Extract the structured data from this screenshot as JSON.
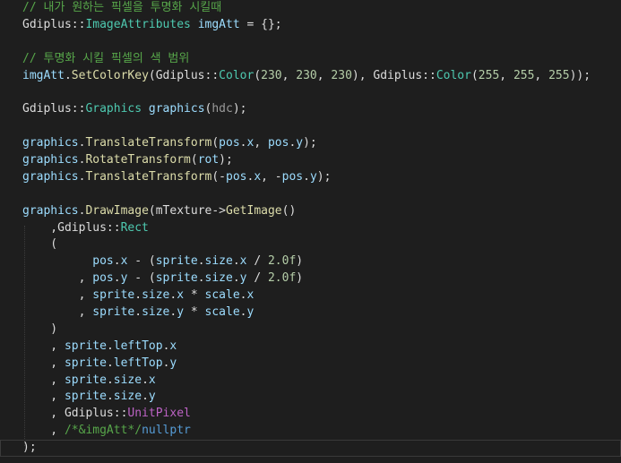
{
  "editor": {
    "language": "C++",
    "theme_colors": {
      "background": "#1e1e1e",
      "comment": "#57a64a",
      "type": "#4ec9b0",
      "function": "#dcdcaa",
      "variable": "#9cdcfe",
      "number": "#b5cea8",
      "plain": "#dcdcdc",
      "keyword": "#569cd6",
      "parameter": "#9a9a9a"
    },
    "lines": [
      [
        {
          "t": "// 내가 원하는 픽셀을 투명화 시킬때",
          "k": "cm"
        }
      ],
      [
        {
          "t": "Gdiplus",
          "k": "pl"
        },
        {
          "t": "::",
          "k": "pl"
        },
        {
          "t": "ImageAttributes",
          "k": "ty"
        },
        {
          "t": " ",
          "k": "pl"
        },
        {
          "t": "imgAtt",
          "k": "vr"
        },
        {
          "t": " = {};",
          "k": "pl"
        }
      ],
      [],
      [
        {
          "t": "// 투명화 시킬 픽셀의 색 범위",
          "k": "cm"
        }
      ],
      [
        {
          "t": "imgAtt",
          "k": "vr"
        },
        {
          "t": ".",
          "k": "pl"
        },
        {
          "t": "SetColorKey",
          "k": "fn"
        },
        {
          "t": "(Gdiplus::",
          "k": "pl"
        },
        {
          "t": "Color",
          "k": "ty"
        },
        {
          "t": "(",
          "k": "pl"
        },
        {
          "t": "230",
          "k": "nm"
        },
        {
          "t": ", ",
          "k": "pl"
        },
        {
          "t": "230",
          "k": "nm"
        },
        {
          "t": ", ",
          "k": "pl"
        },
        {
          "t": "230",
          "k": "nm"
        },
        {
          "t": "), Gdiplus::",
          "k": "pl"
        },
        {
          "t": "Color",
          "k": "ty"
        },
        {
          "t": "(",
          "k": "pl"
        },
        {
          "t": "255",
          "k": "nm"
        },
        {
          "t": ", ",
          "k": "pl"
        },
        {
          "t": "255",
          "k": "nm"
        },
        {
          "t": ", ",
          "k": "pl"
        },
        {
          "t": "255",
          "k": "nm"
        },
        {
          "t": "));",
          "k": "pl"
        }
      ],
      [],
      [
        {
          "t": "Gdiplus",
          "k": "pl"
        },
        {
          "t": "::",
          "k": "pl"
        },
        {
          "t": "Graphics",
          "k": "ty"
        },
        {
          "t": " ",
          "k": "pl"
        },
        {
          "t": "graphics",
          "k": "vr"
        },
        {
          "t": "(",
          "k": "pl"
        },
        {
          "t": "hdc",
          "k": "pm"
        },
        {
          "t": ");",
          "k": "pl"
        }
      ],
      [],
      [
        {
          "t": "graphics",
          "k": "vr"
        },
        {
          "t": ".",
          "k": "pl"
        },
        {
          "t": "TranslateTransform",
          "k": "fn"
        },
        {
          "t": "(",
          "k": "pl"
        },
        {
          "t": "pos",
          "k": "vr"
        },
        {
          "t": ".",
          "k": "pl"
        },
        {
          "t": "x",
          "k": "vr"
        },
        {
          "t": ", ",
          "k": "pl"
        },
        {
          "t": "pos",
          "k": "vr"
        },
        {
          "t": ".",
          "k": "pl"
        },
        {
          "t": "y",
          "k": "vr"
        },
        {
          "t": ");",
          "k": "pl"
        }
      ],
      [
        {
          "t": "graphics",
          "k": "vr"
        },
        {
          "t": ".",
          "k": "pl"
        },
        {
          "t": "RotateTransform",
          "k": "fn"
        },
        {
          "t": "(",
          "k": "pl"
        },
        {
          "t": "rot",
          "k": "vr"
        },
        {
          "t": ");",
          "k": "pl"
        }
      ],
      [
        {
          "t": "graphics",
          "k": "vr"
        },
        {
          "t": ".",
          "k": "pl"
        },
        {
          "t": "TranslateTransform",
          "k": "fn"
        },
        {
          "t": "(-",
          "k": "pl"
        },
        {
          "t": "pos",
          "k": "vr"
        },
        {
          "t": ".",
          "k": "pl"
        },
        {
          "t": "x",
          "k": "vr"
        },
        {
          "t": ", -",
          "k": "pl"
        },
        {
          "t": "pos",
          "k": "vr"
        },
        {
          "t": ".",
          "k": "pl"
        },
        {
          "t": "y",
          "k": "vr"
        },
        {
          "t": ");",
          "k": "pl"
        }
      ],
      [],
      [
        {
          "t": "graphics",
          "k": "vr"
        },
        {
          "t": ".",
          "k": "pl"
        },
        {
          "t": "DrawImage",
          "k": "fn"
        },
        {
          "t": "(",
          "k": "pl"
        },
        {
          "t": "mTexture",
          "k": "pl"
        },
        {
          "t": "->",
          "k": "pl"
        },
        {
          "t": "GetImage",
          "k": "fn"
        },
        {
          "t": "()",
          "k": "pl"
        }
      ],
      [
        {
          "t": "    ,Gdiplus::",
          "k": "pl"
        },
        {
          "t": "Rect",
          "k": "ty"
        }
      ],
      [
        {
          "t": "    (",
          "k": "pl"
        }
      ],
      [
        {
          "t": "          ",
          "k": "pl"
        },
        {
          "t": "pos",
          "k": "vr"
        },
        {
          "t": ".",
          "k": "pl"
        },
        {
          "t": "x",
          "k": "vr"
        },
        {
          "t": " - (",
          "k": "pl"
        },
        {
          "t": "sprite",
          "k": "vr"
        },
        {
          "t": ".",
          "k": "pl"
        },
        {
          "t": "size",
          "k": "vr"
        },
        {
          "t": ".",
          "k": "pl"
        },
        {
          "t": "x",
          "k": "vr"
        },
        {
          "t": " / ",
          "k": "pl"
        },
        {
          "t": "2.0f",
          "k": "nm"
        },
        {
          "t": ")",
          "k": "pl"
        }
      ],
      [
        {
          "t": "        , ",
          "k": "pl"
        },
        {
          "t": "pos",
          "k": "vr"
        },
        {
          "t": ".",
          "k": "pl"
        },
        {
          "t": "y",
          "k": "vr"
        },
        {
          "t": " - (",
          "k": "pl"
        },
        {
          "t": "sprite",
          "k": "vr"
        },
        {
          "t": ".",
          "k": "pl"
        },
        {
          "t": "size",
          "k": "vr"
        },
        {
          "t": ".",
          "k": "pl"
        },
        {
          "t": "y",
          "k": "vr"
        },
        {
          "t": " / ",
          "k": "pl"
        },
        {
          "t": "2.0f",
          "k": "nm"
        },
        {
          "t": ")",
          "k": "pl"
        }
      ],
      [
        {
          "t": "        , ",
          "k": "pl"
        },
        {
          "t": "sprite",
          "k": "vr"
        },
        {
          "t": ".",
          "k": "pl"
        },
        {
          "t": "size",
          "k": "vr"
        },
        {
          "t": ".",
          "k": "pl"
        },
        {
          "t": "x",
          "k": "vr"
        },
        {
          "t": " * ",
          "k": "pl"
        },
        {
          "t": "scale",
          "k": "vr"
        },
        {
          "t": ".",
          "k": "pl"
        },
        {
          "t": "x",
          "k": "vr"
        }
      ],
      [
        {
          "t": "        , ",
          "k": "pl"
        },
        {
          "t": "sprite",
          "k": "vr"
        },
        {
          "t": ".",
          "k": "pl"
        },
        {
          "t": "size",
          "k": "vr"
        },
        {
          "t": ".",
          "k": "pl"
        },
        {
          "t": "y",
          "k": "vr"
        },
        {
          "t": " * ",
          "k": "pl"
        },
        {
          "t": "scale",
          "k": "vr"
        },
        {
          "t": ".",
          "k": "pl"
        },
        {
          "t": "y",
          "k": "vr"
        }
      ],
      [
        {
          "t": "    )",
          "k": "pl"
        }
      ],
      [
        {
          "t": "    , ",
          "k": "pl"
        },
        {
          "t": "sprite",
          "k": "vr"
        },
        {
          "t": ".",
          "k": "pl"
        },
        {
          "t": "leftTop",
          "k": "vr"
        },
        {
          "t": ".",
          "k": "pl"
        },
        {
          "t": "x",
          "k": "vr"
        }
      ],
      [
        {
          "t": "    , ",
          "k": "pl"
        },
        {
          "t": "sprite",
          "k": "vr"
        },
        {
          "t": ".",
          "k": "pl"
        },
        {
          "t": "leftTop",
          "k": "vr"
        },
        {
          "t": ".",
          "k": "pl"
        },
        {
          "t": "y",
          "k": "vr"
        }
      ],
      [
        {
          "t": "    , ",
          "k": "pl"
        },
        {
          "t": "sprite",
          "k": "vr"
        },
        {
          "t": ".",
          "k": "pl"
        },
        {
          "t": "size",
          "k": "vr"
        },
        {
          "t": ".",
          "k": "pl"
        },
        {
          "t": "x",
          "k": "vr"
        }
      ],
      [
        {
          "t": "    , ",
          "k": "pl"
        },
        {
          "t": "sprite",
          "k": "vr"
        },
        {
          "t": ".",
          "k": "pl"
        },
        {
          "t": "size",
          "k": "vr"
        },
        {
          "t": ".",
          "k": "pl"
        },
        {
          "t": "y",
          "k": "vr"
        }
      ],
      [
        {
          "t": "    , Gdiplus::",
          "k": "pl"
        },
        {
          "t": "UnitPixel",
          "k": "mc"
        }
      ],
      [
        {
          "t": "    , ",
          "k": "pl"
        },
        {
          "t": "/*&imgAtt*/",
          "k": "cm"
        },
        {
          "t": "nullptr",
          "k": "kw"
        }
      ],
      [
        {
          "t": ");",
          "k": "pl"
        }
      ]
    ],
    "current_line_index": 26
  }
}
